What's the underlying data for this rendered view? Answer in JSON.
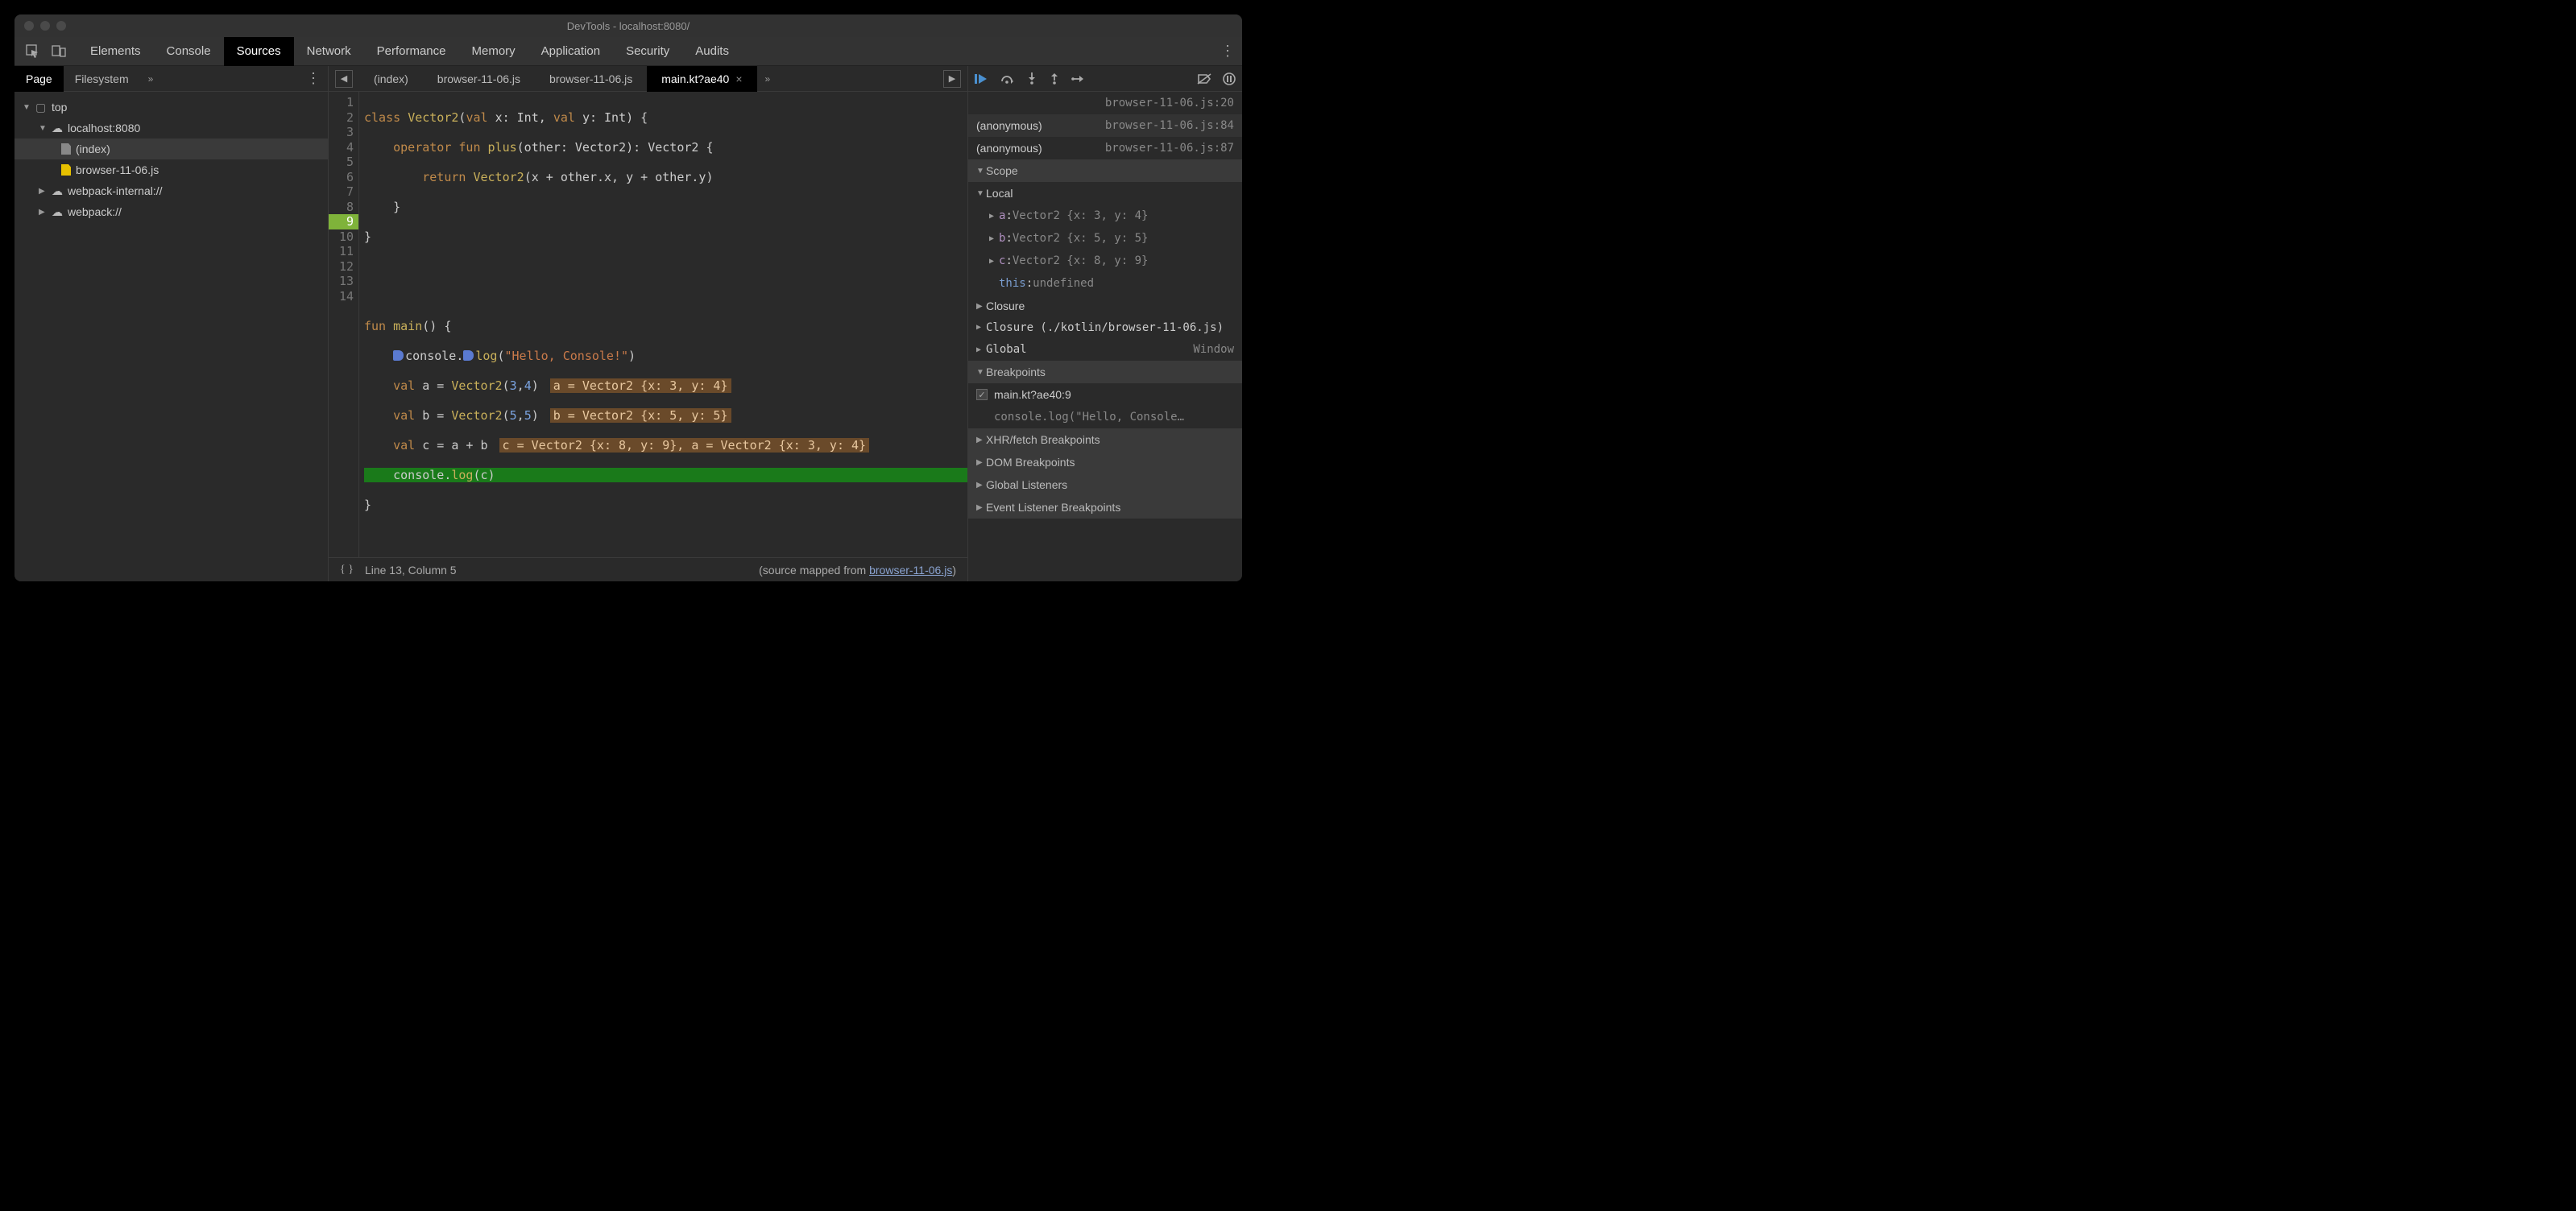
{
  "window": {
    "title": "DevTools - localhost:8080/"
  },
  "top_tabs": [
    "Elements",
    "Console",
    "Sources",
    "Network",
    "Performance",
    "Memory",
    "Application",
    "Security",
    "Audits"
  ],
  "top_active": "Sources",
  "nav": {
    "tabs": [
      "Page",
      "Filesystem"
    ],
    "active": "Page",
    "tree": {
      "top": "top",
      "host": "localhost:8080",
      "index": "(index)",
      "file": "browser-11-06.js",
      "wpi": "webpack-internal://",
      "wp": "webpack://"
    }
  },
  "files": {
    "list": [
      "(index)",
      "browser-11-06.js",
      "browser-11-06.js",
      "main.kt?ae40"
    ],
    "active": "main.kt?ae40"
  },
  "code": {
    "l1a": "class ",
    "l1b": "Vector2",
    "l1c": "(",
    "l1d": "val ",
    "l1e": "x: Int, ",
    "l1f": "val ",
    "l1g": "y: Int) {",
    "l2a": "    operator ",
    "l2b": "fun ",
    "l2c": "plus",
    "l2d": "(other: Vector2): Vector2 {",
    "l3a": "        return ",
    "l3b": "Vector2",
    "l3c": "(x + other.x, y + other.y)",
    "l4": "    }",
    "l5": "}",
    "l8a": "fun ",
    "l8b": "main",
    "l8c": "() {",
    "l9a": "console.",
    "l9b": "log",
    "l9c": "(",
    "l9d": "\"Hello, Console!\"",
    "l9e": ")",
    "l10a": "    val ",
    "l10b": "a = ",
    "l10c": "Vector2",
    "l10d": "(",
    "l10e": "3",
    "l10f": ",",
    "l10g": "4",
    "l10h": ")",
    "l10i": "a = Vector2 {x: 3, y: 4}",
    "l11a": "    val ",
    "l11b": "b = ",
    "l11c": "Vector2",
    "l11d": "(",
    "l11e": "5",
    "l11f": ",",
    "l11g": "5",
    "l11h": ")",
    "l11i": "b = Vector2 {x: 5, y: 5}",
    "l12a": "    val ",
    "l12b": "c = a + b",
    "l12i": "c = Vector2 {x: 8, y: 9}, a = Vector2 {x: 3, y: 4}",
    "l13a": "    console.",
    "l13b": "log",
    "l13c": "(c)",
    "l14": "}"
  },
  "status": {
    "pos": "Line 13, Column 5",
    "map_pre": "(source mapped from ",
    "map_link": "browser-11-06.js",
    "map_post": ")"
  },
  "callstack": {
    "top_loc": "browser-11-06.js:20",
    "rows": [
      {
        "name": "(anonymous)",
        "loc": "browser-11-06.js:84"
      },
      {
        "name": "(anonymous)",
        "loc": "browser-11-06.js:87"
      }
    ]
  },
  "scope": {
    "title": "Scope",
    "local": "Local",
    "vars": [
      {
        "n": "a",
        "v": "Vector2 {x: 3, y: 4}"
      },
      {
        "n": "b",
        "v": "Vector2 {x: 5, y: 5}"
      },
      {
        "n": "c",
        "v": "Vector2 {x: 8, y: 9}"
      }
    ],
    "this": "this",
    "thisv": "undefined",
    "closure": "Closure",
    "closure2": "Closure (./kotlin/browser-11-06.js)",
    "global": "Global",
    "window": "Window"
  },
  "bp": {
    "title": "Breakpoints",
    "name": "main.kt?ae40:9",
    "code": "console.log(\"Hello, Console…"
  },
  "sections": {
    "xhr": "XHR/fetch Breakpoints",
    "dom": "DOM Breakpoints",
    "gl": "Global Listeners",
    "ev": "Event Listener Breakpoints"
  }
}
